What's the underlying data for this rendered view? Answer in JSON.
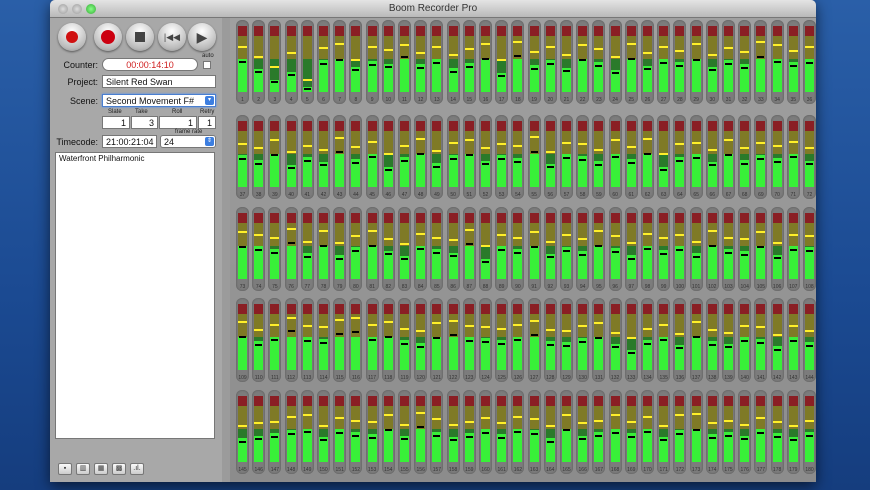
{
  "window": {
    "title": "Boom Recorder Pro"
  },
  "transport": {
    "buttons": [
      "record-arm",
      "record",
      "stop",
      "rewind",
      "play"
    ]
  },
  "counter": {
    "label": "Counter:",
    "value": "00:00:14:10",
    "auto_label": "auto",
    "color": "#d02020"
  },
  "project": {
    "label": "Project:",
    "value": "Silent Red Swan"
  },
  "scene": {
    "label": "Scene:",
    "value": "Second Movement F#"
  },
  "take_fields": [
    {
      "label": "Slate",
      "value": "1"
    },
    {
      "label": "Take",
      "value": "3"
    },
    {
      "label": "Roll",
      "value": "1"
    },
    {
      "label": "Retry",
      "value": "1"
    }
  ],
  "timecode": {
    "label": "Timecode:",
    "value": "21:00:21:04",
    "frame_rate_label": "frame rate",
    "frame_rate": "24"
  },
  "notes": {
    "value": "Waterfront Philharmonic"
  },
  "bottom_buttons": [
    "layout-1",
    "layout-2",
    "layout-3",
    "grid",
    "waveform"
  ],
  "meter_colors": {
    "lit_green": "#38f038",
    "dim_green": "#2a7a2a",
    "olive": "#7f7a26",
    "red": "#8a1f24",
    "peak": "#ffef2a"
  },
  "meters": {
    "levels": [
      52,
      35,
      18,
      31,
      7,
      49,
      55,
      38,
      47,
      43,
      60,
      42,
      50,
      36,
      44,
      58,
      29,
      62,
      41,
      49,
      37,
      55,
      46,
      33,
      58,
      40,
      51,
      45,
      56,
      38,
      48,
      42,
      60,
      53,
      45,
      50,
      48,
      41,
      55,
      33,
      46,
      38,
      60,
      42,
      52,
      30,
      45,
      57,
      36,
      49,
      55,
      40,
      48,
      44,
      61,
      35,
      50,
      47,
      39,
      53,
      42,
      58,
      31,
      46,
      50,
      38,
      55,
      41,
      49,
      44,
      53,
      40,
      55,
      50,
      45,
      62,
      39,
      57,
      36,
      48,
      58,
      43,
      35,
      52,
      46,
      40,
      60,
      31,
      50,
      45,
      55,
      38,
      49,
      42,
      57,
      47,
      36,
      53,
      44,
      51,
      39,
      58,
      46,
      42,
      55,
      37,
      50,
      48,
      58,
      44,
      52,
      67,
      50,
      47,
      62,
      66,
      52,
      58,
      45,
      41,
      55,
      60,
      50,
      48,
      45,
      52,
      60,
      44,
      42,
      49,
      56,
      40,
      30,
      46,
      52,
      38,
      58,
      44,
      40,
      51,
      47,
      36,
      50,
      42,
      36,
      40,
      44,
      48,
      52,
      38,
      50,
      46,
      42,
      55,
      40,
      60,
      46,
      38,
      44,
      50,
      42,
      52,
      48,
      36,
      55,
      40,
      46,
      50,
      44,
      52,
      38,
      48,
      56,
      42,
      46,
      40,
      50,
      44,
      38,
      46
    ],
    "peaks": [
      70,
      55,
      40,
      60,
      20,
      68,
      75,
      50,
      70,
      65,
      72,
      60,
      70,
      58,
      66,
      74,
      50,
      78,
      62,
      70,
      58,
      72,
      66,
      55,
      75,
      60,
      70,
      64,
      74,
      58,
      68,
      62,
      78,
      72,
      64,
      70,
      66,
      60,
      72,
      55,
      64,
      58,
      76,
      62,
      70,
      52,
      64,
      74,
      56,
      68,
      72,
      60,
      66,
      64,
      78,
      55,
      68,
      66,
      58,
      72,
      62,
      74,
      52,
      66,
      68,
      58,
      72,
      60,
      68,
      64,
      70,
      60,
      72,
      68,
      64,
      78,
      58,
      74,
      56,
      66,
      74,
      62,
      55,
      70,
      64,
      60,
      76,
      52,
      68,
      64,
      72,
      58,
      68,
      62,
      74,
      66,
      56,
      70,
      64,
      68,
      58,
      74,
      64,
      62,
      72,
      56,
      68,
      66,
      74,
      62,
      70,
      80,
      68,
      66,
      78,
      80,
      70,
      74,
      64,
      60,
      72,
      76,
      68,
      66,
      64,
      70,
      76,
      62,
      60,
      68,
      72,
      58,
      50,
      64,
      70,
      56,
      74,
      62,
      58,
      68,
      66,
      55,
      68,
      60,
      56,
      60,
      62,
      70,
      72,
      56,
      68,
      64,
      62,
      72,
      58,
      76,
      66,
      58,
      62,
      68,
      60,
      70,
      66,
      56,
      72,
      60,
      64,
      72,
      62,
      70,
      56,
      72,
      74,
      60,
      64,
      58,
      68,
      62,
      56,
      64
    ]
  }
}
